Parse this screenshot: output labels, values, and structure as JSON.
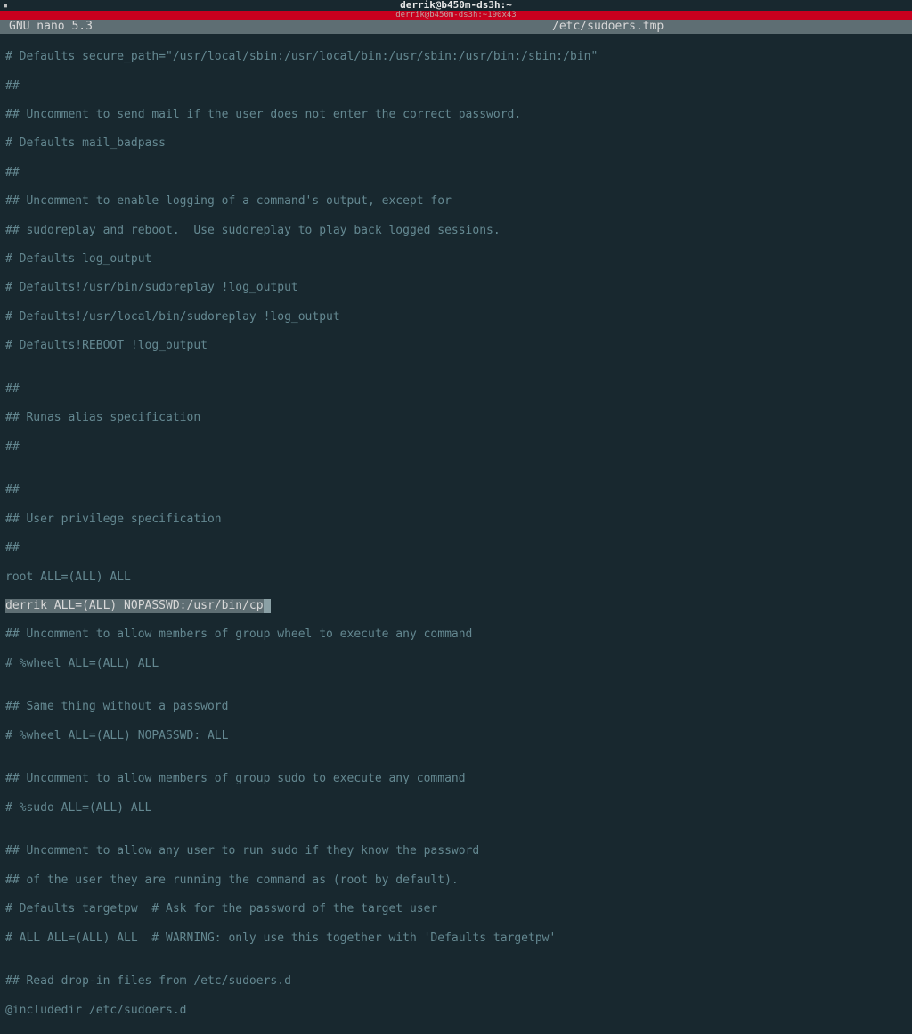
{
  "window": {
    "title": "derrik@b450m-ds3h:~",
    "left_icon": "▪"
  },
  "redbar": {
    "text": "derrik@b450m-ds3h:~190x43"
  },
  "nano_header": {
    "version": "GNU nano 5.3",
    "filename": "/etc/sudoers.tmp"
  },
  "editor_lines": {
    "l01": "# Defaults secure_path=\"/usr/local/sbin:/usr/local/bin:/usr/sbin:/usr/bin:/sbin:/bin\"",
    "l02": "##",
    "l03": "## Uncomment to send mail if the user does not enter the correct password.",
    "l04": "# Defaults mail_badpass",
    "l05": "##",
    "l06": "## Uncomment to enable logging of a command's output, except for",
    "l07": "## sudoreplay and reboot.  Use sudoreplay to play back logged sessions.",
    "l08": "# Defaults log_output",
    "l09": "# Defaults!/usr/bin/sudoreplay !log_output",
    "l10": "# Defaults!/usr/local/bin/sudoreplay !log_output",
    "l11": "# Defaults!REBOOT !log_output",
    "l12": "",
    "l13": "##",
    "l14": "## Runas alias specification",
    "l15": "##",
    "l16": "",
    "l17": "##",
    "l18": "## User privilege specification",
    "l19": "##",
    "l20": "root ALL=(ALL) ALL",
    "highlighted": "derrik ALL=(ALL) NOPASSWD:/usr/bin/cp",
    "l22": "## Uncomment to allow members of group wheel to execute any command",
    "l23": "# %wheel ALL=(ALL) ALL",
    "l24": "",
    "l25": "## Same thing without a password",
    "l26": "# %wheel ALL=(ALL) NOPASSWD: ALL",
    "l27": "",
    "l28": "## Uncomment to allow members of group sudo to execute any command",
    "l29": "# %sudo ALL=(ALL) ALL",
    "l30": "",
    "l31": "## Uncomment to allow any user to run sudo if they know the password",
    "l32": "## of the user they are running the command as (root by default).",
    "l33": "# Defaults targetpw  # Ask for the password of the target user",
    "l34": "# ALL ALL=(ALL) ALL  # WARNING: only use this together with 'Defaults targetpw'",
    "l35": "",
    "l36": "## Read drop-in files from /etc/sudoers.d",
    "l37": "@includedir /etc/sudoers.d"
  }
}
